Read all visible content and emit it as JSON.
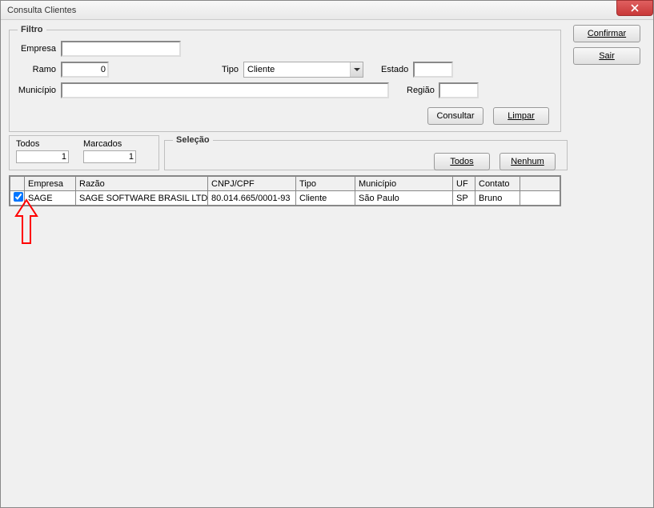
{
  "title": "Consulta Clientes",
  "filter": {
    "legend": "Filtro",
    "labels": {
      "empresa": "Empresa",
      "ramo": "Ramo",
      "tipo": "Tipo",
      "estado": "Estado",
      "municipio": "Município",
      "regiao": "Região"
    },
    "values": {
      "empresa": "",
      "ramo": "0",
      "tipo": "Cliente",
      "estado": "",
      "municipio": "",
      "regiao": ""
    },
    "buttons": {
      "consultar": "Consultar",
      "limpar": "Limpar"
    }
  },
  "counts": {
    "todos_label": "Todos",
    "todos_value": "1",
    "marcados_label": "Marcados",
    "marcados_value": "1"
  },
  "selection": {
    "legend": "Seleção",
    "todos": "Todos",
    "nenhum": "Nenhum"
  },
  "grid": {
    "headers": {
      "chk": "",
      "empresa": "Empresa",
      "razao": "Razão",
      "cnpj": "CNPJ/CPF",
      "tipo": "Tipo",
      "municipio": "Município",
      "uf": "UF",
      "contato": "Contato"
    },
    "rows": [
      {
        "checked": true,
        "empresa": "SAGE",
        "razao": "SAGE SOFTWARE BRASIL LTD",
        "cnpj": "80.014.665/0001-93",
        "tipo": "Cliente",
        "municipio": "São Paulo",
        "uf": "SP",
        "contato": "Bruno"
      }
    ]
  },
  "side": {
    "confirmar": "Confirmar",
    "sair": "Sair"
  }
}
